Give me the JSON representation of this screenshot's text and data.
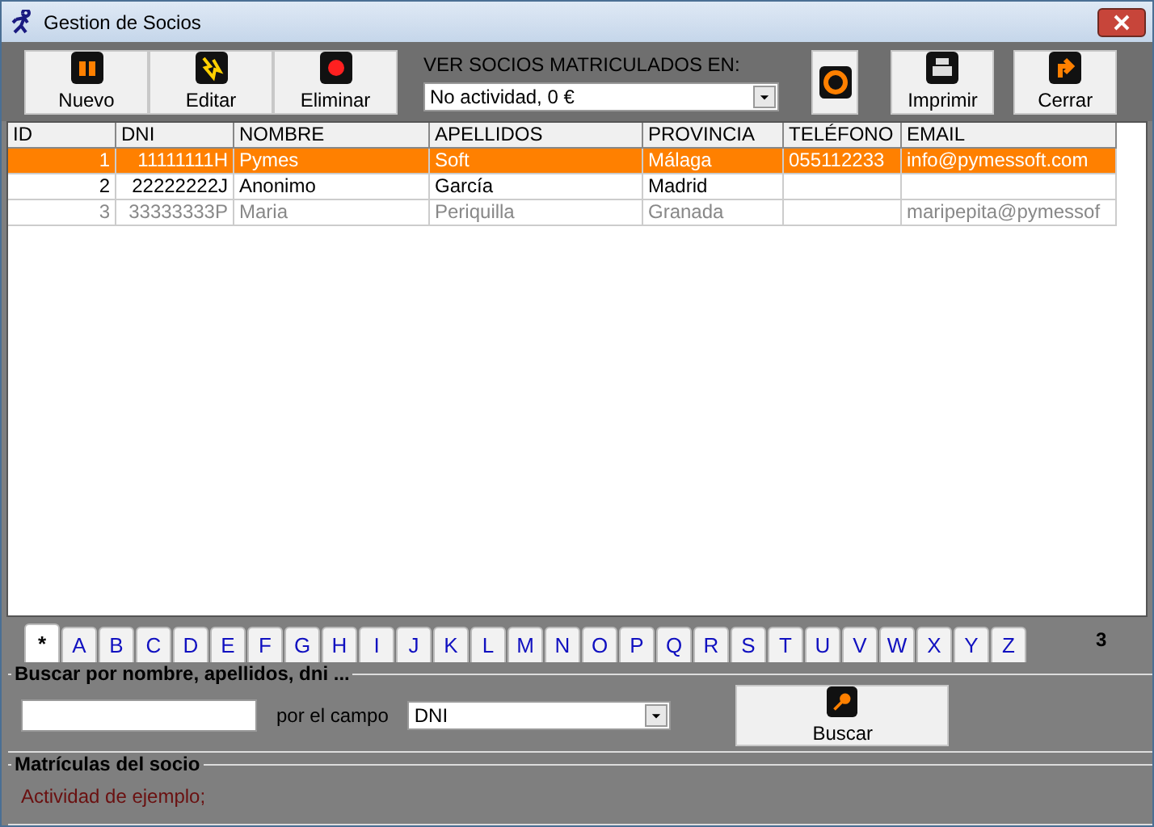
{
  "window": {
    "title": "Gestion de Socios"
  },
  "toolbar": {
    "buttons": [
      {
        "label": "Nuevo",
        "kind": "new"
      },
      {
        "label": "Editar",
        "kind": "edit"
      },
      {
        "label": "Eliminar",
        "kind": "delete"
      }
    ],
    "filter_label": "VER SOCIOS MATRICULADOS EN:",
    "filter_value": "No actividad, 0 €",
    "right_buttons": [
      {
        "kind": "recycle"
      },
      {
        "label": "Imprimir",
        "kind": "print"
      },
      {
        "label": "Cerrar",
        "kind": "close"
      }
    ]
  },
  "table": {
    "columns": [
      "ID",
      "DNI",
      "NOMBRE",
      "APELLIDOS",
      "PROVINCIA",
      "TELÉFONO",
      "EMAIL"
    ],
    "rows": [
      {
        "cells": [
          "1",
          "11111111H",
          "Pymes",
          "Soft",
          "Málaga",
          "055112233",
          "info@pymessoft.com"
        ],
        "selected": true,
        "inactive": false
      },
      {
        "cells": [
          "2",
          "22222222J",
          "Anonimo",
          "García",
          "Madrid",
          "",
          ""
        ],
        "selected": false,
        "inactive": false
      },
      {
        "cells": [
          "3",
          "33333333P",
          "Maria",
          "Periquilla",
          "Granada",
          "",
          "maripepita@pymessof"
        ],
        "selected": false,
        "inactive": true
      }
    ]
  },
  "letters": [
    {
      "label": "*",
      "selected": true
    },
    {
      "label": "A",
      "selected": false
    },
    {
      "label": "B",
      "selected": false
    },
    {
      "label": "C",
      "selected": false
    },
    {
      "label": "D",
      "selected": false
    },
    {
      "label": "E",
      "selected": false
    },
    {
      "label": "F",
      "selected": false
    },
    {
      "label": "G",
      "selected": false
    },
    {
      "label": "H",
      "selected": false
    },
    {
      "label": "I",
      "selected": false
    },
    {
      "label": "J",
      "selected": false
    },
    {
      "label": "K",
      "selected": false
    },
    {
      "label": "L",
      "selected": false
    },
    {
      "label": "M",
      "selected": false
    },
    {
      "label": "N",
      "selected": false
    },
    {
      "label": "O",
      "selected": false
    },
    {
      "label": "P",
      "selected": false
    },
    {
      "label": "Q",
      "selected": false
    },
    {
      "label": "R",
      "selected": false
    },
    {
      "label": "S",
      "selected": false
    },
    {
      "label": "T",
      "selected": false
    },
    {
      "label": "U",
      "selected": false
    },
    {
      "label": "V",
      "selected": false
    },
    {
      "label": "W",
      "selected": false
    },
    {
      "label": "X",
      "selected": false
    },
    {
      "label": "Y",
      "selected": false
    },
    {
      "label": "Z",
      "selected": false
    }
  ],
  "record_count": "3",
  "search": {
    "title": "Buscar por nombre, apellidos, dni ...",
    "field_label": "por el campo",
    "field_value": "DNI",
    "button": "Buscar"
  },
  "enrollments": {
    "title": "Matrículas del socio",
    "text": "Actividad de ejemplo;"
  }
}
